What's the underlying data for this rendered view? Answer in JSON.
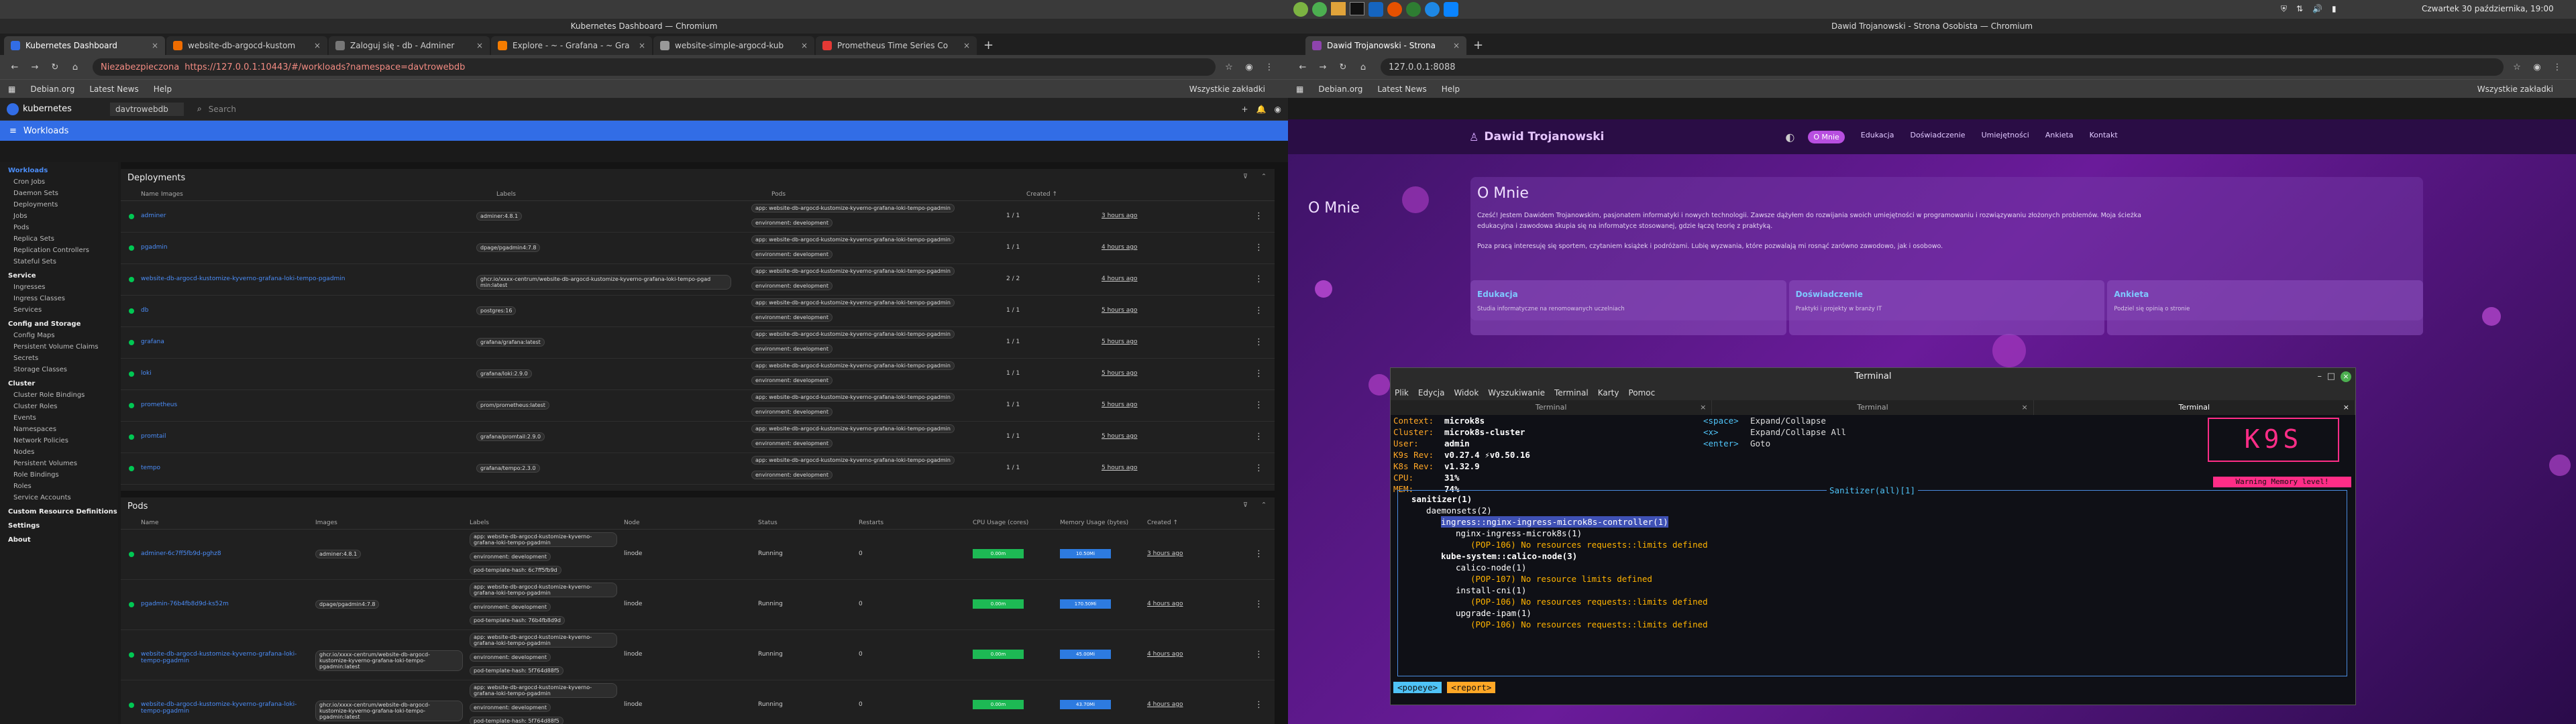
{
  "topbar": {
    "datetime": "Czwartek 30 października, 19:00"
  },
  "left": {
    "window_title": "Kubernetes Dashboard — Chromium",
    "tabs": [
      "Kubernetes Dashboard",
      "website-db-argocd-kustom",
      "Zaloguj się - db - Adminer",
      "Explore - ~ - Grafana - ~ Gra",
      "website-simple-argocd-kub",
      "Prometheus Time Series Co"
    ],
    "not_secure": "Niezabezpieczona",
    "url": "https://127.0.0.1:10443/#/workloads?namespace=davtrowebdb",
    "bookmarks": [
      "Debian.org",
      "Latest News",
      "Help"
    ],
    "all_bookmarks": "Wszystkie zakładki",
    "app_name": "kubernetes",
    "namespace": "davtrowebdb",
    "search": "Search",
    "section": "Workloads",
    "sidebar": [
      {
        "h": "Workloads"
      },
      {
        "i": "Cron Jobs"
      },
      {
        "i": "Daemon Sets"
      },
      {
        "i": "Deployments"
      },
      {
        "i": "Jobs"
      },
      {
        "i": "Pods"
      },
      {
        "i": "Replica Sets"
      },
      {
        "i": "Replication Controllers"
      },
      {
        "i": "Stateful Sets"
      },
      {
        "h": "Service"
      },
      {
        "i": "Ingresses"
      },
      {
        "i": "Ingress Classes"
      },
      {
        "i": "Services"
      },
      {
        "h": "Config and Storage"
      },
      {
        "i": "Config Maps"
      },
      {
        "i": "Persistent Volume Claims"
      },
      {
        "i": "Secrets"
      },
      {
        "i": "Storage Classes"
      },
      {
        "h": "Cluster"
      },
      {
        "i": "Cluster Role Bindings"
      },
      {
        "i": "Cluster Roles"
      },
      {
        "i": "Events"
      },
      {
        "i": "Namespaces"
      },
      {
        "i": "Network Policies"
      },
      {
        "i": "Nodes"
      },
      {
        "i": "Persistent Volumes"
      },
      {
        "i": "Role Bindings"
      },
      {
        "i": "Roles"
      },
      {
        "i": "Service Accounts"
      },
      {
        "h": "Custom Resource Definitions"
      },
      {
        "h": "Settings"
      },
      {
        "h": "About"
      }
    ],
    "deployments": {
      "title": "Deployments",
      "headers": [
        "Name",
        "Images",
        "Labels",
        "Pods",
        "Created ↑"
      ],
      "rows": [
        [
          "adminer",
          "adminer:4.8.1",
          "1 / 1",
          "3 hours ago"
        ],
        [
          "pgadmin",
          "dpage/pgadmin4:7.8",
          "1 / 1",
          "4 hours ago"
        ],
        [
          "website-db-argocd-kustomize-kyverno-grafana-loki-tempo-pgadmin",
          "ghcr.io/xxxx-centrum/website-db-argocd-kustomize-kyverno-grafana-loki-tempo-pgad min:latest",
          "2 / 2",
          "4 hours ago"
        ],
        [
          "db",
          "postgres:16",
          "1 / 1",
          "5 hours ago"
        ],
        [
          "grafana",
          "grafana/grafana:latest",
          "1 / 1",
          "5 hours ago"
        ],
        [
          "loki",
          "grafana/loki:2.9.0",
          "1 / 1",
          "5 hours ago"
        ],
        [
          "prometheus",
          "prom/prometheus:latest",
          "1 / 1",
          "5 hours ago"
        ],
        [
          "promtail",
          "grafana/promtail:2.9.0",
          "1 / 1",
          "5 hours ago"
        ],
        [
          "tempo",
          "grafana/tempo:2.3.0",
          "1 / 1",
          "5 hours ago"
        ]
      ],
      "label1": "app: website-db-argocd-kustomize-kyverno-grafana-loki-tempo-pgadmin",
      "label2": "environment: development"
    },
    "pods": {
      "title": "Pods",
      "headers": [
        "Name",
        "Images",
        "Labels",
        "Node",
        "Status",
        "Restarts",
        "CPU Usage (cores)",
        "Memory Usage (bytes)",
        "Created ↑"
      ],
      "rows": [
        [
          "adminer-6c7ff5fb9d-pghz8",
          "adminer:4.8.1",
          "pod-template-hash: 6c7ff5fb9d",
          "linode",
          "Running",
          "0",
          "0.00m",
          "10.50Mi",
          "3 hours ago"
        ],
        [
          "pgadmin-76b4fb8d9d-ks52m",
          "dpage/pgadmin4:7.8",
          "pod-template-hash: 76b4fb8d9d",
          "linode",
          "Running",
          "0",
          "0.00m",
          "170.50Mi",
          "4 hours ago"
        ],
        [
          "website-db-argocd-kustomize-kyverno-grafana-loki-tempo-pgadmin",
          "ghcr.io/xxxx-centrum/website-db-argocd-kustomize-kyverno-grafana-loki-tempo-pgadmin:latest",
          "pod-template-hash: 5f764d88f5",
          "linode",
          "Running",
          "0",
          "0.00m",
          "45.00Mi",
          "4 hours ago"
        ],
        [
          "website-db-argocd-kustomize-kyverno-grafana-loki-tempo-pgadmin",
          "ghcr.io/xxxx-centrum/website-db-argocd-kustomize-kyverno-grafana-loki-tempo-pgadmin:latest",
          "pod-template-hash: 5f764d88f5",
          "linode",
          "Running",
          "0",
          "0.00m",
          "43.70Mi",
          "4 hours ago"
        ]
      ]
    }
  },
  "right": {
    "window_title": "Dawid Trojanowski - Strona Osobista — Chromium",
    "tab": "Dawid Trojanowski - Strona",
    "url": "127.0.0.1:8088",
    "site_name": "Dawid Trojanowski",
    "nav": [
      "O Mnie",
      "Edukacja",
      "Doświadczenie",
      "Umiejętności",
      "Ankieta",
      "Kontakt"
    ],
    "heading": "O Mnie",
    "p1": "Cześć! Jestem Dawidem Trojanowskim, pasjonatem informatyki i nowych technologii. Zawsze dążyłem do rozwijania swoich umiejętności w programowaniu i rozwiązywaniu złożonych problemów. Moja ścieżka edukacyjna i zawodowa skupia się na informatyce stosowanej, gdzie łączę teorię z praktyką.",
    "p2": "Poza pracą interesuję się sportem, czytaniem książek i podróżami. Lubię wyzwania, które pozwalają mi rosnąć zarówno zawodowo, jak i osobowo.",
    "cards": [
      {
        "t": "Edukacja",
        "d": "Studia informatyczne na renomowanych uczelniach"
      },
      {
        "t": "Doświadczenie",
        "d": "Praktyki i projekty w branży IT"
      },
      {
        "t": "Ankieta",
        "d": "Podziel się opinią o stronie"
      }
    ]
  },
  "terminal": {
    "title": "Terminal",
    "menu": [
      "Plik",
      "Edycja",
      "Widok",
      "Wyszukiwanie",
      "Terminal",
      "Karty",
      "Pomoc"
    ],
    "tabs": [
      "Terminal",
      "Terminal",
      "Terminal"
    ],
    "info": [
      [
        "Context:",
        "microk8s"
      ],
      [
        "Cluster:",
        "microk8s-cluster"
      ],
      [
        "User:",
        "admin"
      ],
      [
        "K9s Rev:",
        "v0.27.4 ⚡v0.50.16"
      ],
      [
        "K8s Rev:",
        "v1.32.9"
      ],
      [
        "CPU:",
        "31%"
      ],
      [
        "MEM:",
        "74%"
      ]
    ],
    "keys": [
      [
        "<space>",
        "Expand/Collapse"
      ],
      [
        "<x>",
        "Expand/Collapse All"
      ],
      [
        "<enter>",
        "Goto"
      ]
    ],
    "warning": "Warning Memory level!",
    "panel_title": "Sanitizer(all)[1]",
    "tree": [
      [
        "sanitizer(1)",
        0,
        "w"
      ],
      [
        "daemonsets(2)",
        1,
        "m"
      ],
      [
        "ingress::nginx-ingress-microk8s-controller(1)",
        2,
        "s"
      ],
      [
        "nginx-ingress-microk8s(1)",
        3,
        "w"
      ],
      [
        "(POP-106) No resources requests::limits defined",
        4,
        "o"
      ],
      [
        "kube-system::calico-node(3)",
        2,
        "w"
      ],
      [
        "calico-node(1)",
        3,
        "w"
      ],
      [
        "(POP-107) No resource limits defined",
        4,
        "o"
      ],
      [
        "install-cni(1)",
        3,
        "w"
      ],
      [
        "(POP-106) No resources requests::limits defined",
        4,
        "o"
      ],
      [
        "upgrade-ipam(1)",
        3,
        "w"
      ],
      [
        "(POP-106) No resources requests::limits defined",
        4,
        "o"
      ]
    ],
    "crumbs": [
      "<popeye>",
      "<report>"
    ]
  }
}
